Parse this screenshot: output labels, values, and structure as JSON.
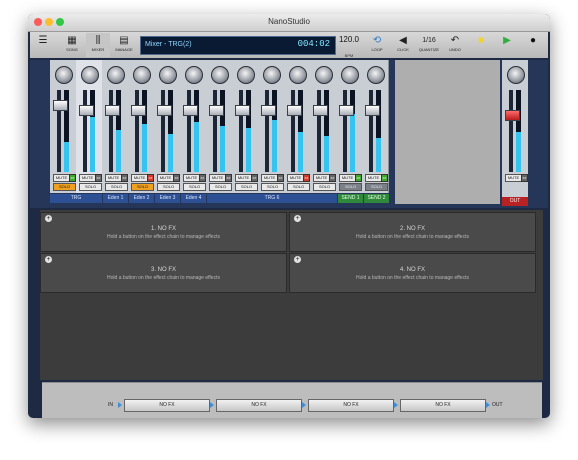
{
  "window": {
    "title": "NanoStudio"
  },
  "toolbar": {
    "song": "SONG",
    "mixer": "MIXER",
    "manage": "MANAGE",
    "lcd_name": "Mixer - TRG(2)",
    "lcd_time": "004:02",
    "bpm_value": "120.0",
    "bpm_label": "BPM",
    "loop": "LOOP",
    "click": "CLICK",
    "quantize_value": "1/16",
    "quantize_label": "QUANTIZE",
    "undo": "UNDO"
  },
  "mixer": {
    "mute": "MUTE",
    "solo": "SOLO",
    "fx": "FX",
    "groups": [
      "TRG",
      "Eden 1",
      "Eden 2",
      "Eden 3",
      "Eden 4",
      "TRG 6",
      "SEND 1",
      "SEND 2"
    ],
    "out_label": "OUT"
  },
  "fx_slots": [
    {
      "title": "1. NO FX",
      "subtitle": "Hold a button on the effect chain to manage effects"
    },
    {
      "title": "2. NO FX",
      "subtitle": "Hold a button on the effect chain to manage effects"
    },
    {
      "title": "3. NO FX",
      "subtitle": "Hold a button on the effect chain to manage effects"
    },
    {
      "title": "4. NO FX",
      "subtitle": "Hold a button on the effect chain to manage effects"
    }
  ],
  "chain": {
    "in": "IN",
    "out": "OUT",
    "slots": [
      "NO FX",
      "NO FX",
      "NO FX",
      "NO FX"
    ]
  },
  "colors": {
    "accent": "#3c8fd8",
    "solo_active": "#f0a020",
    "send": "#2e8a3a",
    "out": "#b92222"
  }
}
